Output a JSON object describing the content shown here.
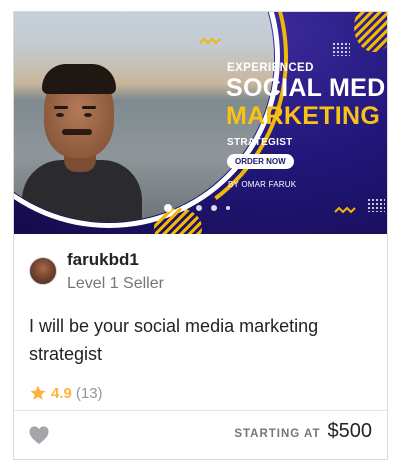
{
  "hero": {
    "ad": {
      "line1": "EXPERIENCED",
      "line2": "SOCIAL MEDIA",
      "line3": "MARKETING",
      "line4": "STRATEGIST",
      "cta": "ORDER NOW",
      "byline": "BY OMAR FARUK"
    },
    "carousel": {
      "count": 5,
      "active_index": 0
    }
  },
  "seller": {
    "name": "farukbd1",
    "level": "Level 1 Seller"
  },
  "gig": {
    "title": "I will be your social media marketing strategist"
  },
  "rating": {
    "value": "4.9",
    "count": "(13)",
    "star_color": "#ffb33e"
  },
  "footer": {
    "starting_at": "STARTING AT",
    "price": "$500"
  },
  "colors": {
    "brand_dark": "#1e1270",
    "accent_yellow": "#f8c315"
  }
}
